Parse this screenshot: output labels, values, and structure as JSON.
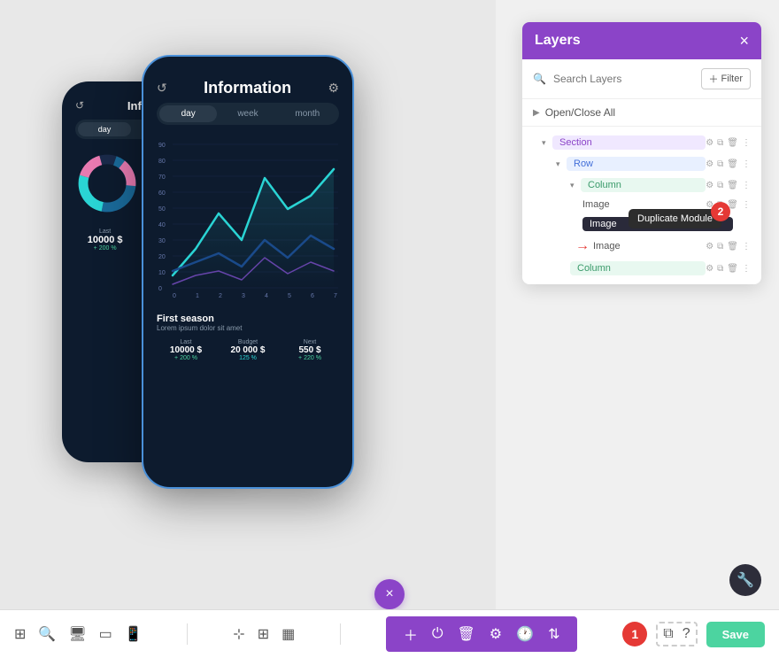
{
  "panel": {
    "title": "Layers",
    "close_label": "×",
    "search_placeholder": "Search Layers",
    "filter_label": "+ Filter",
    "open_close_label": "Open/Close All",
    "tree": [
      {
        "id": "section",
        "label": "Section",
        "type": "section",
        "indent": 0,
        "toggle": "▾",
        "has_icons": true
      },
      {
        "id": "row",
        "label": "Row",
        "type": "row",
        "indent": 1,
        "toggle": "▾",
        "has_icons": true
      },
      {
        "id": "column1",
        "label": "Column",
        "type": "column",
        "indent": 2,
        "toggle": "▾",
        "has_icons": true
      },
      {
        "id": "image1",
        "label": "Image",
        "type": "image",
        "indent": 3,
        "has_icons": true
      },
      {
        "id": "image2",
        "label": "Image",
        "type": "image-selected",
        "indent": 3,
        "has_icons": true,
        "tooltip": "Duplicate Module",
        "badge": "2"
      },
      {
        "id": "image3",
        "label": "Image",
        "type": "image-arrow",
        "indent": 3,
        "has_icons": true
      },
      {
        "id": "column2",
        "label": "Column",
        "type": "column",
        "indent": 2,
        "has_icons": true
      }
    ]
  },
  "phone_front": {
    "title": "Information",
    "tabs": [
      "day",
      "week",
      "month"
    ],
    "active_tab": "day",
    "chart_y_labels": [
      "90",
      "80",
      "70",
      "60",
      "50",
      "40",
      "30",
      "20",
      "10",
      "0"
    ],
    "chart_x_labels": [
      "0",
      "1",
      "2",
      "3",
      "4",
      "5",
      "6",
      "7"
    ],
    "season_label": "First season",
    "season_desc": "Lorem ipsum dolor sit amet",
    "stats": [
      {
        "label": "Last",
        "value": "10000 $",
        "change": "+ 200 %"
      },
      {
        "label": "Budget",
        "value": "20 000 $",
        "change": "125 %"
      },
      {
        "label": "Next",
        "value": "550 $",
        "change": "+ 220 %"
      }
    ]
  },
  "toolbar": {
    "left_icons": [
      "grid-icon",
      "search-icon",
      "monitor-icon",
      "tablet-icon",
      "phone-icon"
    ],
    "center_icons": [
      "select-icon",
      "grid2-icon",
      "layout-icon"
    ],
    "close_label": "×",
    "bottom_icons": [
      "plus-icon",
      "power-icon",
      "trash-icon",
      "settings-icon",
      "clock-icon",
      "sliders-icon"
    ],
    "save_label": "Save",
    "badge1": "1",
    "badge2": "2"
  }
}
